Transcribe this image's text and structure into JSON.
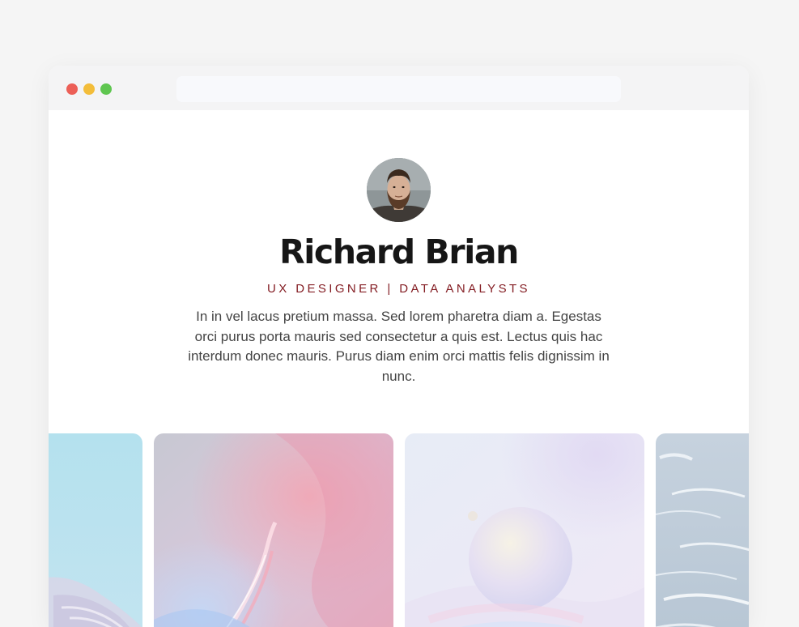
{
  "window": {
    "controls": [
      "close",
      "minimize",
      "maximize"
    ],
    "address_bar": {
      "value": ""
    }
  },
  "profile": {
    "avatar_alt": "",
    "name": "Richard Brian",
    "role": "UX DESIGNER | DATA ANALYSTS",
    "bio": "In in vel lacus pretium massa. Sed lorem pharetra diam a. Egestas orci purus porta mauris sed consectetur a quis est. Lectus quis hac interdum donec mauris. Purus diam enim orci mattis felis dignissim in nunc."
  },
  "gallery": {
    "cards": [
      {
        "theme": "teal-abstract"
      },
      {
        "theme": "light-streak"
      },
      {
        "theme": "pastel-sphere"
      },
      {
        "theme": "ocean-waves"
      }
    ]
  },
  "colors": {
    "page_background": "#f5f5f5",
    "titlebar": "#f4f4f5",
    "address_bar": "#f8f9fc",
    "name_text": "#161616",
    "role_text": "#841e24",
    "bio_text": "#444444",
    "dot_red": "#ec5f57",
    "dot_yellow": "#f3bd3a",
    "dot_green": "#5fc650"
  }
}
